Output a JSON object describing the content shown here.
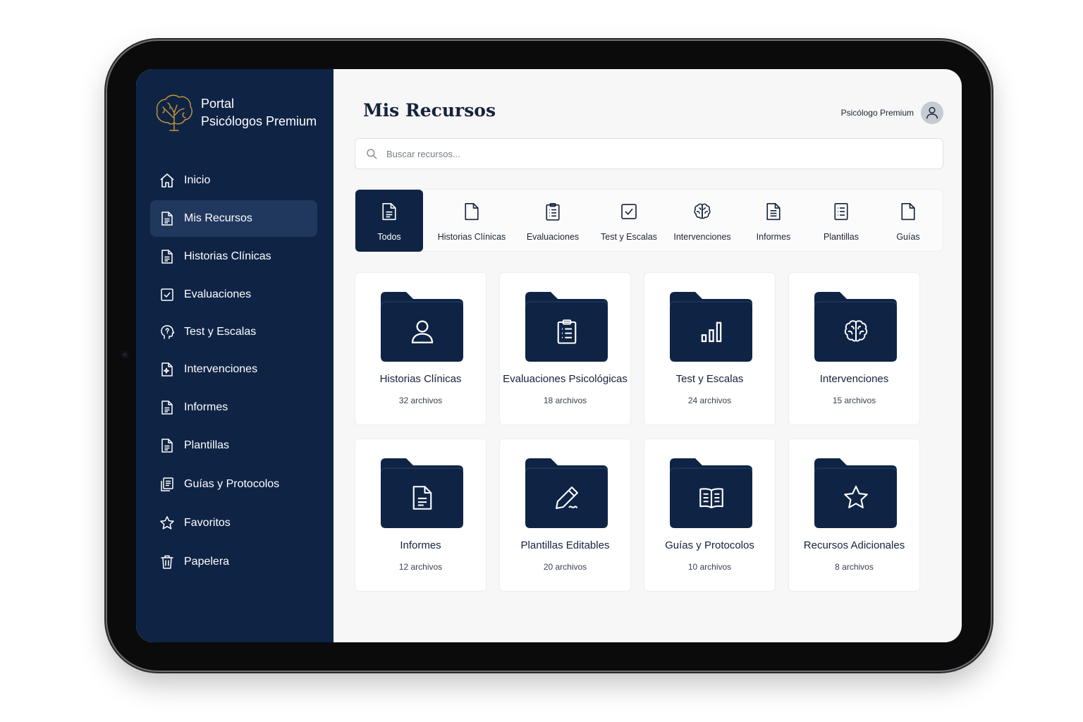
{
  "brand": {
    "line1": "Portal",
    "line2": "Psicólogos Premium"
  },
  "sidebar": {
    "items": [
      {
        "label": "Inicio",
        "icon": "home-icon"
      },
      {
        "label": "Mis Recursos",
        "icon": "document-icon",
        "active": true
      },
      {
        "label": "Historias Clínicas",
        "icon": "document-icon"
      },
      {
        "label": "Evaluaciones",
        "icon": "checkbox-icon"
      },
      {
        "label": "Test y Escalas",
        "icon": "head-icon"
      },
      {
        "label": "Intervenciones",
        "icon": "sparkle-document-icon"
      },
      {
        "label": "Informes",
        "icon": "document-icon"
      },
      {
        "label": "Plantillas",
        "icon": "document-icon"
      },
      {
        "label": "Guías y Protocolos",
        "icon": "stacked-documents-icon"
      },
      {
        "label": "Favoritos",
        "icon": "star-icon"
      },
      {
        "label": "Papelera",
        "icon": "trash-icon"
      }
    ]
  },
  "header": {
    "title": "Mis Recursos",
    "user_name": "Psicólogo Premium"
  },
  "search": {
    "placeholder": "Buscar recursos...",
    "value": ""
  },
  "tabs": [
    {
      "label": "Todos",
      "icon": "document-icon",
      "active": true
    },
    {
      "label": "Historias Clínicas",
      "icon": "file-icon"
    },
    {
      "label": "Evaluaciones",
      "icon": "clipboard-icon"
    },
    {
      "label": "Test y Escalas",
      "icon": "checkbox-icon"
    },
    {
      "label": "Intervenciones",
      "icon": "brain-icon"
    },
    {
      "label": "Informes",
      "icon": "document-icon"
    },
    {
      "label": "Plantillas",
      "icon": "list-icon"
    },
    {
      "label": "Guías",
      "icon": "file-icon"
    }
  ],
  "folders": [
    {
      "title": "Historias Clínicas",
      "count": "32 archivos",
      "icon": "person-icon"
    },
    {
      "title": "Evaluaciones Psicológicas",
      "count": "18 archivos",
      "icon": "clipboard-icon"
    },
    {
      "title": "Test y Escalas",
      "count": "24 archivos",
      "icon": "bar-chart-icon"
    },
    {
      "title": "Intervenciones",
      "count": "15 archivos",
      "icon": "brain-icon"
    },
    {
      "title": "Informes",
      "count": "12 archivos",
      "icon": "document-icon"
    },
    {
      "title": "Plantillas Editables",
      "count": "20 archivos",
      "icon": "pencil-icon"
    },
    {
      "title": "Guías y Protocolos",
      "count": "10 archivos",
      "icon": "book-icon"
    },
    {
      "title": "Recursos Adicionales",
      "count": "8 archivos",
      "icon": "star-icon"
    }
  ],
  "colors": {
    "navy": "#0f2445",
    "active_nav": "#21385e",
    "gold": "#c9973a",
    "background": "#f7f7f8"
  }
}
